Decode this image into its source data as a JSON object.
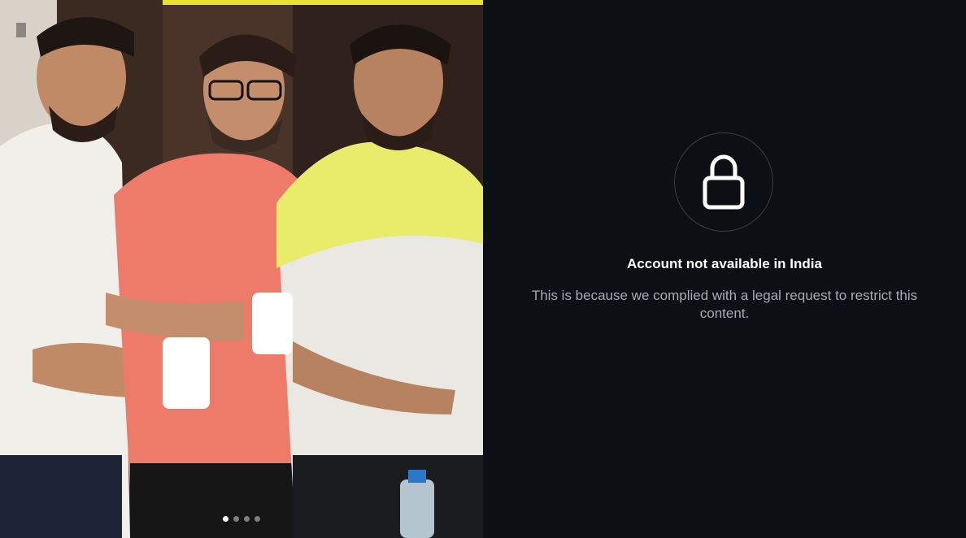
{
  "restricted": {
    "title": "Account not available in India",
    "description": "This is because we complied with a legal request to restrict this content."
  },
  "carousel": {
    "total_slides": 4,
    "active_slide": 1
  },
  "colors": {
    "background": "#0c0f14",
    "title_text": "#ffffff",
    "body_text": "#a8abb2",
    "circle_border": "#3a3d44"
  },
  "icons": {
    "lock": "lock-icon"
  }
}
